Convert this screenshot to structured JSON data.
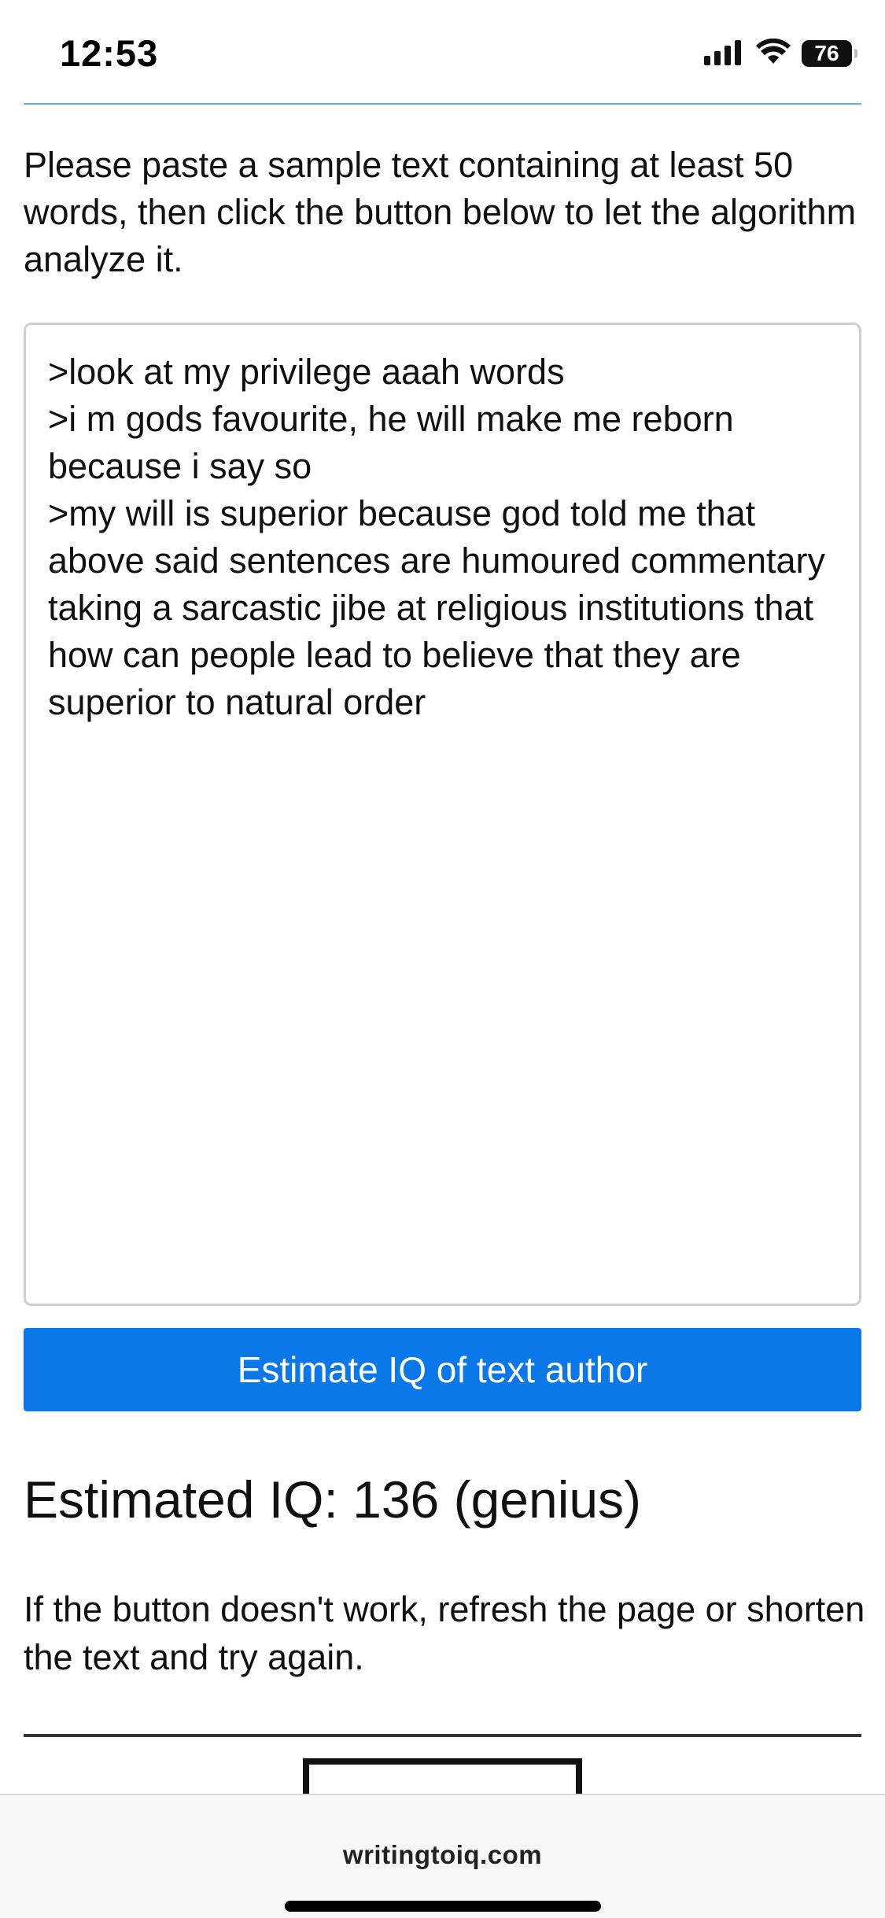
{
  "status_bar": {
    "time": "12:53",
    "battery": "76",
    "icons": [
      "signal-icon",
      "wifi-icon",
      "battery-icon"
    ]
  },
  "page": {
    "instructions": "Please paste a sample text containing at least 50 words, then click the button below to let the algorithm analyze it.",
    "text_area_value": ">look at my privilege aaah words\n>i m gods favourite, he will make me reborn because i say so\n>my will is superior because god told me that above said sentences are humoured commentary taking a sarcastic jibe at religious institutions that how can people lead to believe that they are superior to natural order",
    "button_label": "Estimate IQ of text author",
    "result": "Estimated IQ: 136 (genius)",
    "help_text": "If the button doesn't work, refresh the page or shorten the text and try again."
  },
  "browser": {
    "url": "writingtoiq.com"
  },
  "colors": {
    "button": "#0a78e8",
    "top_rule": "#5bb0d6"
  }
}
